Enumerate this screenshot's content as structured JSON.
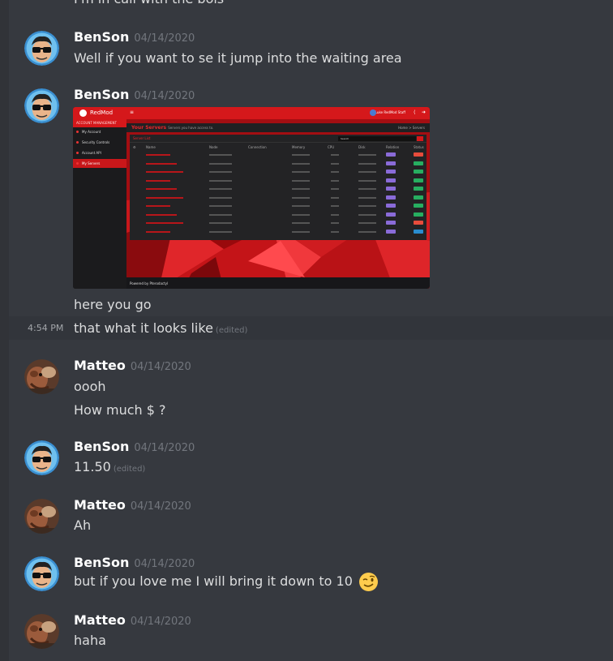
{
  "colors": {
    "background": "#36393f",
    "username": "#ffffff",
    "timestamp": "#72767d",
    "text": "#dcddde",
    "accent_red": "#d5181b"
  },
  "top_partial_text": "I'm in call with the bois",
  "messages": [
    {
      "author": "BenSon",
      "timestamp": "04/14/2020",
      "avatar": "benson-avatar",
      "lines": [
        "Well if you want to se it jump into the waiting area"
      ]
    },
    {
      "author": "BenSon",
      "timestamp": "04/14/2020",
      "avatar": "benson-avatar",
      "caption": "here you go",
      "followup": {
        "time": "4:54 PM",
        "text": "that what it looks like",
        "edited": "(edited)"
      }
    },
    {
      "author": "Matteo",
      "timestamp": "04/14/2020",
      "avatar": "matteo-avatar",
      "lines": [
        "oooh",
        "How much $ ?"
      ]
    },
    {
      "author": "BenSon",
      "timestamp": "04/14/2020",
      "avatar": "benson-avatar",
      "text": "11.50",
      "edited": "(edited)"
    },
    {
      "author": "Matteo",
      "timestamp": "04/14/2020",
      "avatar": "matteo-avatar",
      "lines": [
        "Ah"
      ]
    },
    {
      "author": "BenSon",
      "timestamp": "04/14/2020",
      "avatar": "benson-avatar",
      "text": "but if you love me I will bring it down to 10",
      "emoji": "winking-face-emoji"
    },
    {
      "author": "Matteo",
      "timestamp": "04/14/2020",
      "avatar": "matteo-avatar",
      "lines": [
        "haha"
      ]
    }
  ],
  "attachment": {
    "app_name": "RedMod",
    "user_label": "Luke RedMod Staff",
    "side_header": "ACCOUNT MANAGEMENT",
    "nav": [
      "My Account",
      "Security Controls",
      "Account API",
      "My Servers"
    ],
    "page_title": "Your Servers",
    "page_subtitle": "Servers you have access to.",
    "breadcrumb": "Home > Servers",
    "card_title": "Server List",
    "search_placeholder": "Search",
    "columns": [
      "Name",
      "Node",
      "Connection",
      "Memory",
      "CPU",
      "Disk",
      "Relation",
      "Status"
    ],
    "footer": "Powered by Pterodactyl",
    "pill_colors": {
      "relation": "#8a6bd8",
      "online": "#27ae60",
      "offline": "#e74c3c",
      "starting": "#2a8ccf"
    }
  }
}
